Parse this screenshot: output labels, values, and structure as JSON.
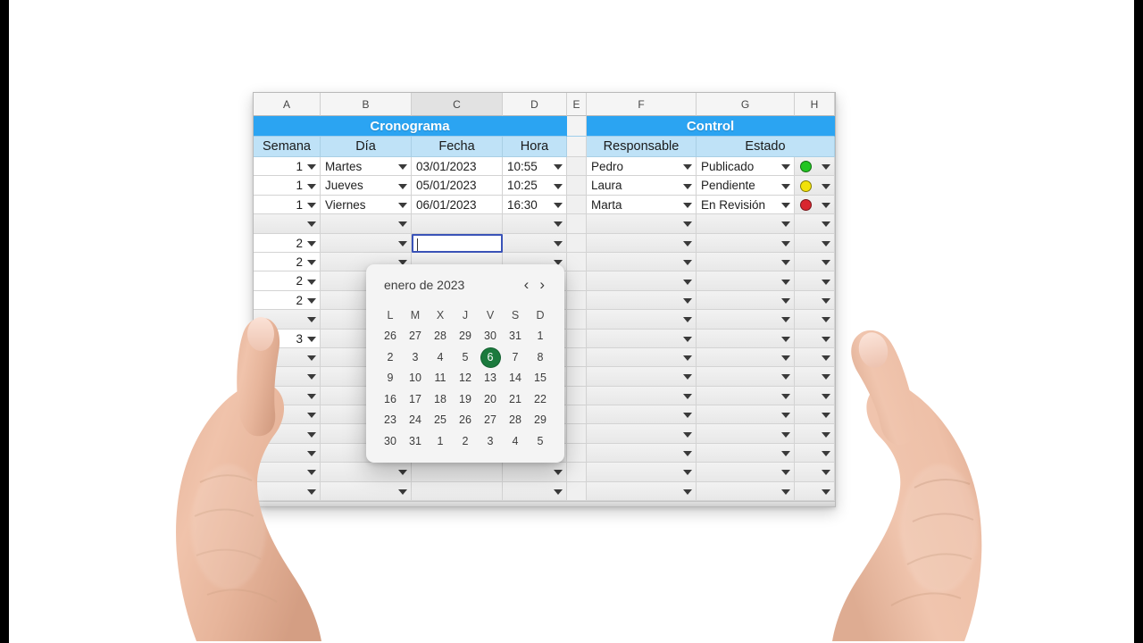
{
  "sheet": {
    "column_letters": [
      "A",
      "B",
      "C",
      "D",
      "E",
      "F",
      "G",
      "H"
    ],
    "active_column": "C",
    "banners": {
      "left": "Cronograma",
      "right": "Control"
    },
    "subheaders": {
      "semana": "Semana",
      "dia": "Día",
      "fecha": "Fecha",
      "hora": "Hora",
      "responsable": "Responsable",
      "estado": "Estado"
    },
    "rows": [
      {
        "semana": "1",
        "dia": "Martes",
        "fecha": "03/01/2023",
        "hora": "10:55",
        "responsable": "Pedro",
        "estado": "Publicado",
        "color": "#22c522"
      },
      {
        "semana": "1",
        "dia": "Jueves",
        "fecha": "05/01/2023",
        "hora": "10:25",
        "responsable": "Laura",
        "estado": "Pendiente",
        "color": "#f2e20a"
      },
      {
        "semana": "1",
        "dia": "Viernes",
        "fecha": "06/01/2023",
        "hora": "16:30",
        "responsable": "Marta",
        "estado": "En Revisión",
        "color": "#d9262f"
      },
      {
        "semana": "",
        "dia": "",
        "fecha": "",
        "hora": "",
        "responsable": "",
        "estado": "",
        "color": ""
      },
      {
        "semana": "2",
        "dia": "",
        "fecha": "",
        "hora": "",
        "responsable": "",
        "estado": "",
        "color": ""
      },
      {
        "semana": "2",
        "dia": "",
        "fecha": "",
        "hora": "",
        "responsable": "",
        "estado": "",
        "color": ""
      },
      {
        "semana": "2",
        "dia": "",
        "fecha": "",
        "hora": "",
        "responsable": "",
        "estado": "",
        "color": ""
      },
      {
        "semana": "2",
        "dia": "",
        "fecha": "",
        "hora": "",
        "responsable": "",
        "estado": "",
        "color": ""
      },
      {
        "semana": "",
        "dia": "",
        "fecha": "",
        "hora": "",
        "responsable": "",
        "estado": "",
        "color": ""
      },
      {
        "semana": "3",
        "dia": "",
        "fecha": "",
        "hora": "",
        "responsable": "",
        "estado": "",
        "color": ""
      },
      {
        "semana": "",
        "dia": "",
        "fecha": "",
        "hora": "",
        "responsable": "",
        "estado": "",
        "color": ""
      },
      {
        "semana": "",
        "dia": "",
        "fecha": "",
        "hora": "",
        "responsable": "",
        "estado": "",
        "color": ""
      },
      {
        "semana": "",
        "dia": "",
        "fecha": "",
        "hora": "",
        "responsable": "",
        "estado": "",
        "color": ""
      },
      {
        "semana": "",
        "dia": "",
        "fecha": "",
        "hora": "",
        "responsable": "",
        "estado": "",
        "color": ""
      },
      {
        "semana": "",
        "dia": "",
        "fecha": "",
        "hora": "",
        "responsable": "",
        "estado": "",
        "color": ""
      },
      {
        "semana": "",
        "dia": "",
        "fecha": "",
        "hora": "",
        "responsable": "",
        "estado": "",
        "color": ""
      },
      {
        "semana": "",
        "dia": "",
        "fecha": "",
        "hora": "",
        "responsable": "",
        "estado": "",
        "color": ""
      },
      {
        "semana": "",
        "dia": "",
        "fecha": "",
        "hora": "",
        "responsable": "",
        "estado": "",
        "color": ""
      }
    ],
    "selected_cell": {
      "row_index": 4,
      "column": "C",
      "value": ""
    }
  },
  "datepicker": {
    "month_label": "enero de 2023",
    "prev_label": "‹",
    "next_label": "›",
    "weekdays": [
      "L",
      "M",
      "X",
      "J",
      "V",
      "S",
      "D"
    ],
    "weeks": [
      [
        "26",
        "27",
        "28",
        "29",
        "30",
        "31",
        "1"
      ],
      [
        "2",
        "3",
        "4",
        "5",
        "6",
        "7",
        "8"
      ],
      [
        "9",
        "10",
        "11",
        "12",
        "13",
        "14",
        "15"
      ],
      [
        "16",
        "17",
        "18",
        "19",
        "20",
        "21",
        "22"
      ],
      [
        "23",
        "24",
        "25",
        "26",
        "27",
        "28",
        "29"
      ],
      [
        "30",
        "31",
        "1",
        "2",
        "3",
        "4",
        "5"
      ]
    ],
    "selected_day": "6",
    "selected_week_index": 1,
    "selected_day_index": 4,
    "selected_color": "#1b7a3d"
  },
  "theme": {
    "banner_blue": "#2ba4f2",
    "subheader_blue": "#bfe2f7",
    "selection_border": "#3a53b8",
    "pillarbox": "#000000",
    "page_background": "#ffffff"
  }
}
